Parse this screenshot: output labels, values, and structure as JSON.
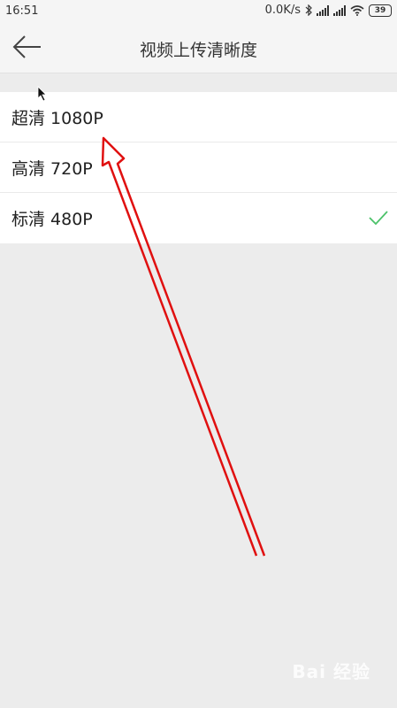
{
  "status_bar": {
    "time": "16:51",
    "net_speed": "0.0K/s",
    "battery_level": "39",
    "icons": [
      "bluetooth-icon",
      "signal-icon",
      "signal-icon",
      "wifi-icon",
      "battery-icon"
    ]
  },
  "header": {
    "title": "视频上传清晰度",
    "back_icon": "arrow-left-icon"
  },
  "options": [
    {
      "label": "超清 1080P",
      "selected": false
    },
    {
      "label": "高清 720P",
      "selected": false
    },
    {
      "label": "标清 480P",
      "selected": true
    }
  ],
  "watermark": "Bai 经验",
  "colors": {
    "check": "#4cc26a",
    "annotation_arrow": "#e01010",
    "background": "#ececec"
  }
}
